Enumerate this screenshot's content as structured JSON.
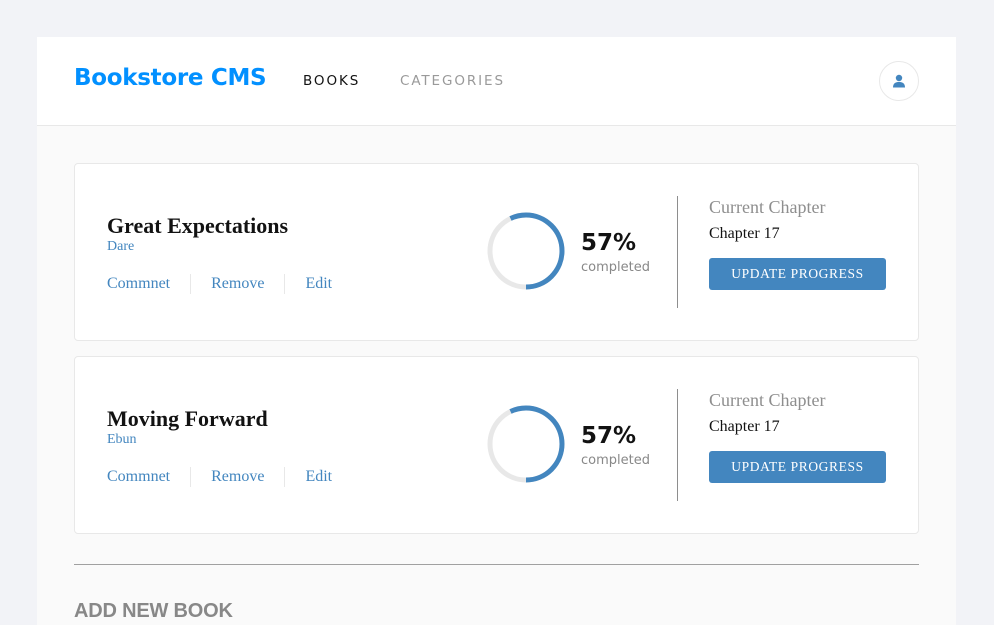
{
  "header": {
    "logo": "Bookstore CMS",
    "nav": {
      "books": "BOOKS",
      "categories": "CATEGORIES"
    },
    "user_icon": "user-icon"
  },
  "books": [
    {
      "title": "Great Expectations",
      "author": "Dare",
      "actions": {
        "comment": "Commnet",
        "remove": "Remove",
        "edit": "Edit"
      },
      "progress_percent": 57,
      "progress_label": "57%",
      "completed_label": "completed",
      "current_chapter_label": "Current Chapter",
      "current_chapter": "Chapter 17",
      "update_button": "UPDATE PROGRESS"
    },
    {
      "title": "Moving Forward",
      "author": "Ebun",
      "actions": {
        "comment": "Commnet",
        "remove": "Remove",
        "edit": "Edit"
      },
      "progress_percent": 57,
      "progress_label": "57%",
      "completed_label": "completed",
      "current_chapter_label": "Current Chapter",
      "current_chapter": "Chapter 17",
      "update_button": "UPDATE PROGRESS"
    }
  ],
  "add_book": {
    "title": "ADD NEW BOOK"
  },
  "colors": {
    "brand": "#0290ff",
    "accent": "#4386bf",
    "track": "#e8e8e8"
  }
}
